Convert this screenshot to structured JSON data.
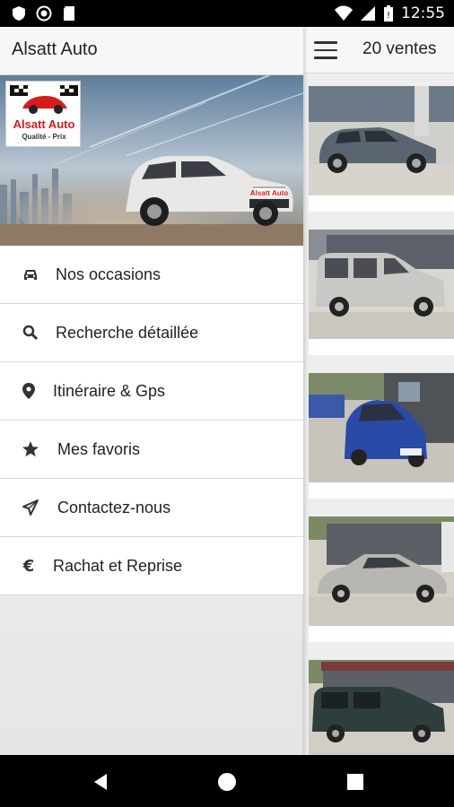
{
  "status_bar": {
    "time": "12:55",
    "left_icons": [
      "shield-icon",
      "circle-icon",
      "sd-card-icon"
    ],
    "right_icons": [
      "wifi-icon",
      "signal-icon",
      "battery-icon"
    ]
  },
  "drawer": {
    "title": "Alsatt Auto",
    "logo": {
      "name": "Alsatt Auto",
      "tagline": "Qualité - Prix"
    },
    "hero_plate": "Alsatt Auto",
    "menu": [
      {
        "label": "Nos occasions",
        "icon": "car-icon"
      },
      {
        "label": "Recherche détaillée",
        "icon": "search-icon"
      },
      {
        "label": "Itinéraire & Gps",
        "icon": "location-pin-icon"
      },
      {
        "label": "Mes favoris",
        "icon": "star-icon"
      },
      {
        "label": "Contactez-nous",
        "icon": "send-icon"
      },
      {
        "label": "Rachat et Reprise",
        "icon": "euro-icon"
      }
    ]
  },
  "main": {
    "title": "20 ventes",
    "listings": [
      {
        "color": "#5a6470"
      },
      {
        "color": "#c8c8c4"
      },
      {
        "color": "#2a4aa8"
      },
      {
        "color": "#b8b6b0"
      },
      {
        "color": "#2e3e3c"
      }
    ]
  },
  "colors": {
    "accent_red": "#d61c1c",
    "toolbar_bg": "#f7f7f7"
  }
}
